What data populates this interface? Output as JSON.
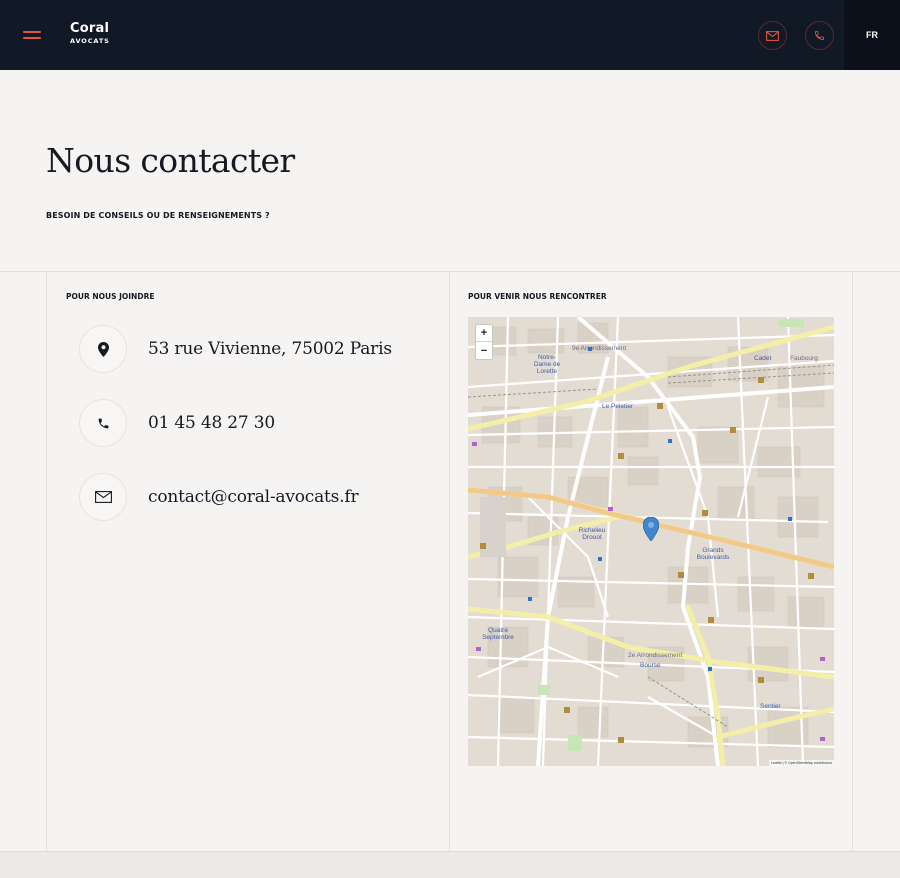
{
  "header": {
    "logo_name": "Coral",
    "logo_sub": "AVOCATS",
    "language": "FR",
    "icons": {
      "menu": "hamburger-icon",
      "mail": "envelope-icon",
      "phone": "phone-icon"
    },
    "colors": {
      "background": "#111826",
      "accent": "#e0563f"
    }
  },
  "hero": {
    "title": "Nous contacter",
    "subtitle": "BESOIN DE CONSEILS OU DE RENSEIGNEMENTS ?"
  },
  "contact": {
    "label": "POUR NOUS JOINDRE",
    "items": [
      {
        "icon": "location-pin-icon",
        "text": "53 rue Vivienne, 75002 Paris"
      },
      {
        "icon": "phone-icon",
        "text": "01 45 48 27 30"
      },
      {
        "icon": "envelope-icon",
        "text": "contact@coral-avocats.fr"
      }
    ]
  },
  "map": {
    "label": "POUR VENIR NOUS RENCONTRER",
    "zoom_in": "+",
    "zoom_out": "−",
    "attribution": "Leaflet | © OpenStreetMap contributors",
    "place_labels": {
      "arr9": "9e Arrondissement",
      "notre_dame": "Notre-Dame de Lorette",
      "le_peletier": "Le Peletier",
      "richelieu": "Richelieu Drouot",
      "grands_boulevards": "Grands Boulevards",
      "quatre_septembre": "Quatre Septembre",
      "arr2": "2e Arrondissement",
      "bourse": "Bourse",
      "sentier": "Sentier",
      "cadet": "Cadet",
      "faubourg": "Faubourg"
    }
  }
}
